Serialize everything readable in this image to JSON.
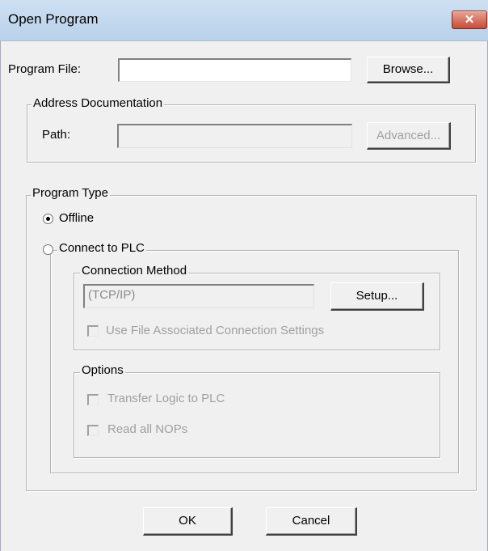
{
  "window": {
    "title": "Open Program",
    "close_glyph": "✕"
  },
  "program_file": {
    "label": "Program File:",
    "value": "",
    "browse_label": "Browse..."
  },
  "address_doc": {
    "legend": "Address Documentation",
    "path_label": "Path:",
    "path_value": "",
    "advanced_label": "Advanced..."
  },
  "program_type": {
    "legend": "Program Type",
    "offline_label": "Offline",
    "offline_selected": true,
    "connect_label": "Connect to PLC",
    "connection_method": {
      "legend": "Connection Method",
      "value": "(TCP/IP)",
      "setup_label": "Setup...",
      "use_file_settings_label": "Use File Associated Connection Settings"
    },
    "options": {
      "legend": "Options",
      "transfer_logic_label": "Transfer Logic to PLC",
      "read_nops_label": "Read all NOPs"
    }
  },
  "footer": {
    "ok_label": "OK",
    "cancel_label": "Cancel"
  }
}
